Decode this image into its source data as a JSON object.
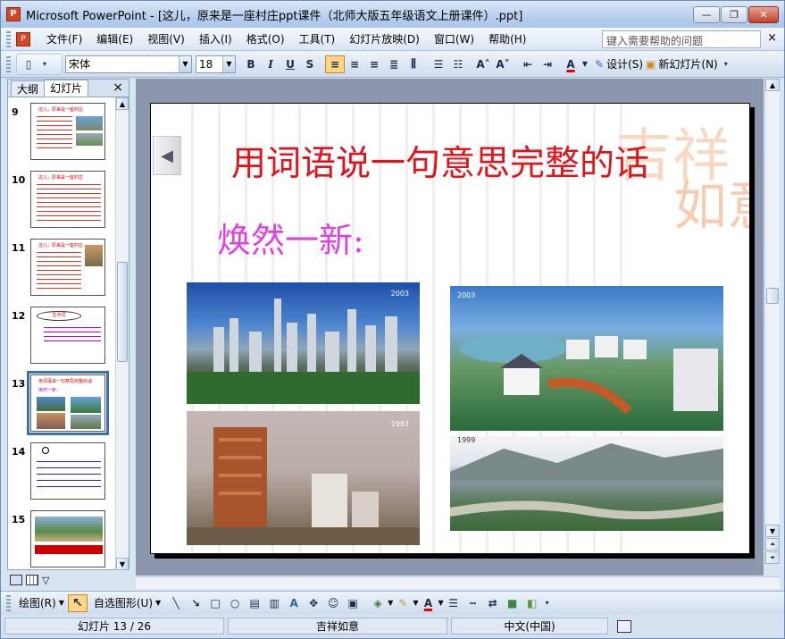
{
  "window": {
    "title": "Microsoft PowerPoint - [这儿，原来是一座村庄ppt课件（北师大版五年级语文上册课件）.ppt]",
    "minimize": "—",
    "restore": "❐",
    "close": "✕"
  },
  "menu": {
    "items": [
      "文件(F)",
      "编辑(E)",
      "视图(V)",
      "插入(I)",
      "格式(O)",
      "工具(T)",
      "幻灯片放映(D)",
      "窗口(W)",
      "帮助(H)"
    ],
    "help_placeholder": "键入需要帮助的问题",
    "close": "×"
  },
  "toolbar": {
    "font": "宋体",
    "size": "18",
    "bold": "B",
    "italic": "I",
    "underline": "U",
    "shadow": "S",
    "increase": "A˄",
    "decrease": "A˅",
    "fontcolor": "A",
    "design": "设计(S)",
    "newslide": "新幻灯片(N)"
  },
  "pane": {
    "tabs": [
      "大纲",
      "幻灯片"
    ],
    "close": "×"
  },
  "thumbnails": [
    {
      "num": "9",
      "lines": [
        "这儿，原来是一座村庄"
      ]
    },
    {
      "num": "10",
      "lines": [
        "这儿，原来是一座村庄"
      ]
    },
    {
      "num": "11",
      "lines": [
        "这儿，原来是一座村庄"
      ]
    },
    {
      "num": "12",
      "lines": [
        "生字词"
      ]
    },
    {
      "num": "13",
      "lines": [
        "用词语说一句意思完整的话",
        "焕然一新："
      ]
    },
    {
      "num": "14",
      "lines": [
        "",
        "",
        ""
      ]
    },
    {
      "num": "15",
      "lines": []
    }
  ],
  "slide": {
    "title": "用词语说一句意思完整的话",
    "subtitle": "焕然一新:",
    "year_a": "2003",
    "year_b": "2003",
    "year_c": "1983",
    "year_d": "1999",
    "deco": "吉祥如意"
  },
  "drawbar": {
    "draw": "绘图(R)",
    "autoshape": "自选图形(U)"
  },
  "status": {
    "slide": "幻灯片 13 / 26",
    "design": "吉祥如意",
    "lang": "中文(中国)"
  },
  "colors": {
    "title": "#e0141a",
    "subtitle": "#e040e0",
    "selected": "#3d6fb5"
  }
}
